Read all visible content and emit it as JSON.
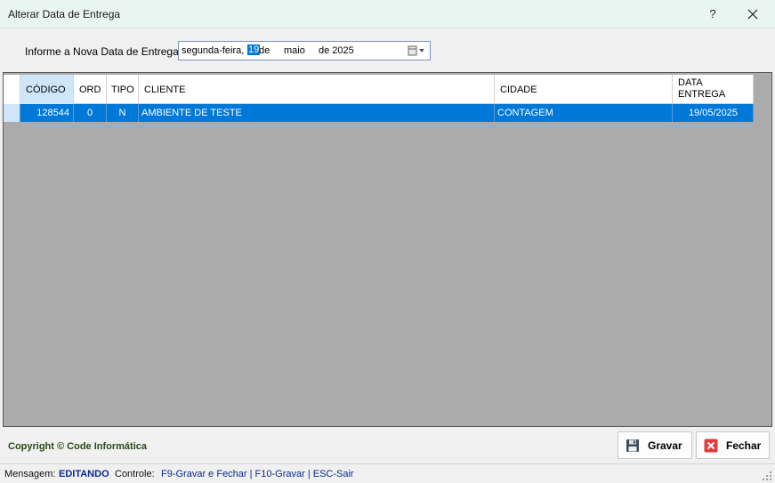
{
  "window": {
    "title": "Alterar Data de Entrega",
    "help_label": "?",
    "close_icon": "close-icon"
  },
  "date_field": {
    "label": "Informe a Nova Data de Entrega:",
    "weekday": "segunda-feira,",
    "day": "19",
    "de1": "de",
    "month": "maio",
    "de2": "de 2025",
    "icon": "calendar-dropdown-icon"
  },
  "grid": {
    "columns": {
      "codigo": "CÓDIGO",
      "ord": "ORD",
      "tipo": "TIPO",
      "cliente": "CLIENTE",
      "cidade": "CIDADE",
      "data_l1": "DATA",
      "data_l2": "ENTREGA"
    },
    "rows": [
      {
        "codigo": "128544",
        "ord": "0",
        "tipo": "N",
        "cliente": "AMBIENTE DE TESTE",
        "cidade": "CONTAGEM",
        "data_entrega": "19/05/2025"
      }
    ],
    "selection_color": "#0078d7",
    "background_color": "#ababab"
  },
  "footer": {
    "copyright": "Copyright © Code Informática",
    "gravar_label": "Gravar",
    "fechar_label": "Fechar"
  },
  "status": {
    "mensagem_label": "Mensagem:",
    "mensagem_value": "EDITANDO",
    "controle_label": "Controle:",
    "controle_value": "F9-Gravar e Fechar  | F10-Gravar  | ESC-Sair"
  }
}
